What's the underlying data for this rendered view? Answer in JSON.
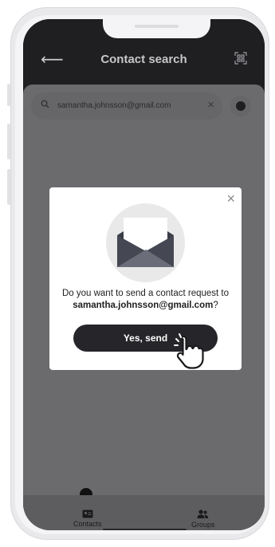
{
  "header": {
    "title": "Contact search"
  },
  "search": {
    "value": "samantha.johnsson@gmail.com"
  },
  "dialog": {
    "message_prefix": "Do you want to send a contact request to",
    "email": "samantha.johnsson@gmail.com",
    "message_suffix": "?",
    "confirm_label": "Yes, send"
  },
  "tabs": [
    {
      "label": "Contacts",
      "icon": "contact-card-icon"
    },
    {
      "label": "Groups",
      "icon": "groups-icon"
    }
  ],
  "colors": {
    "primary": "#26262a",
    "overlay": "#6b6b6e",
    "modal_bg": "#ffffff"
  }
}
